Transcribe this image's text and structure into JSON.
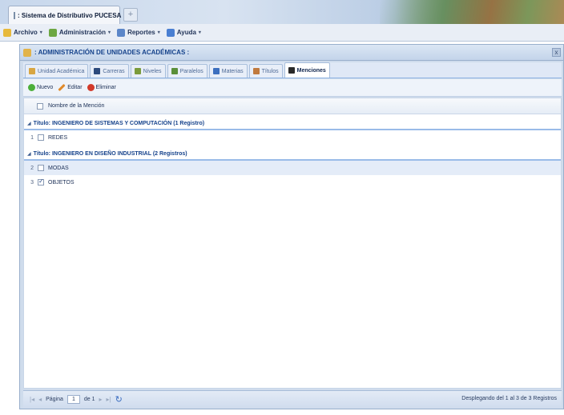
{
  "browser": {
    "tab_title": ": Sistema de Distributivo PUCESA :",
    "new_tab": "+"
  },
  "menubar": {
    "items": [
      {
        "label": "Archivo",
        "caret": "▾",
        "icon_color": "#e7b93c"
      },
      {
        "label": "Administración",
        "caret": "▾",
        "icon_color": "#6da742"
      },
      {
        "label": "Reportes",
        "caret": "▾",
        "icon_color": "#5b86c8"
      },
      {
        "label": "Ayuda",
        "caret": "▾",
        "icon_color": "#4a7fd2"
      }
    ]
  },
  "panel": {
    "title": ": ADMINISTRACIÓN DE UNIDADES ACADÉMICAS :",
    "close": "x"
  },
  "tabs": [
    {
      "label": "Unidad Académica",
      "icon_color": "#d8a642",
      "active": false
    },
    {
      "label": "Carreras",
      "icon_color": "#2d4a7c",
      "active": false
    },
    {
      "label": "Niveles",
      "icon_color": "#7a9b3c",
      "active": false
    },
    {
      "label": "Paralelos",
      "icon_color": "#5a8f3a",
      "active": false
    },
    {
      "label": "Materias",
      "icon_color": "#3c6fbf",
      "active": false
    },
    {
      "label": "Títulos",
      "icon_color": "#c07a3e",
      "active": false
    },
    {
      "label": "Menciones",
      "icon_color": "#2a2a2a",
      "active": true
    }
  ],
  "toolbar": {
    "new_label": "Nuevo",
    "edit_label": "Editar",
    "delete_label": "Eliminar",
    "new_color": "#4caf3a",
    "edit_color": "#e08a2a",
    "delete_color": "#d23a2a"
  },
  "grid": {
    "header_label": "Nombre de la Mención",
    "groups": [
      {
        "label": "Título: INGENIERO DE SISTEMAS Y COMPUTACIÓN (1 Registro)",
        "rows": [
          {
            "n": "1",
            "name": "REDES",
            "checked": false
          }
        ]
      },
      {
        "label": "Título: INGENIERO EN DISEÑO INDUSTRIAL (2 Registros)",
        "rows": [
          {
            "n": "2",
            "name": "MODAS",
            "checked": false
          },
          {
            "n": "3",
            "name": "OBJETOS",
            "checked": true
          }
        ]
      }
    ]
  },
  "pager": {
    "page_label": "Página",
    "page_value": "1",
    "of_label": "de 1",
    "info": "Desplegando del 1 al 3 de 3 Registros"
  }
}
